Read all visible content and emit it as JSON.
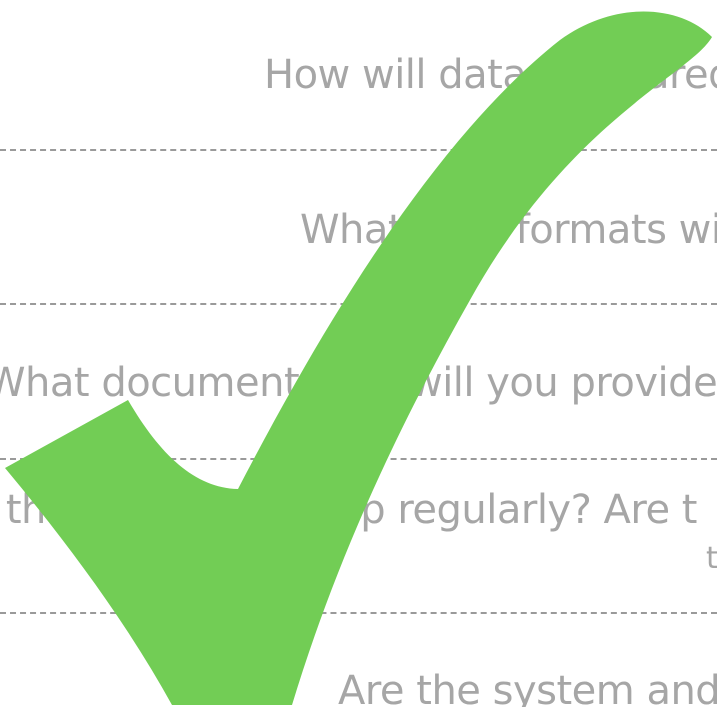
{
  "colors": {
    "text": "#a6a6a6",
    "divider": "#9a9a9a",
    "checkmark": "#72cd55",
    "background": "#ffffff"
  },
  "icon": "checkmark-icon",
  "questions": [
    {
      "text": "How will data be shared"
    },
    {
      "text": "What data formats will you use"
    },
    {
      "text": "What documentation will you provide to"
    },
    {
      "text": "Is the data backed up regularly? Are t"
    },
    {
      "text": "t"
    },
    {
      "text": "Are the system and"
    }
  ]
}
